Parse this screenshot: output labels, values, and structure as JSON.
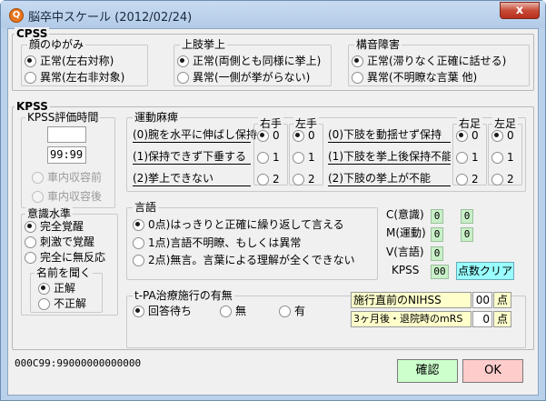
{
  "window": {
    "title": "脳卒中スケール (2012/02/24)",
    "close_label": "x",
    "icon_label": "Q"
  },
  "cpss": {
    "title": "CPSS",
    "face": {
      "title": "顔のゆがみ",
      "options": [
        "正常(左右対称)",
        "異常(左右非対象)"
      ],
      "selected": 0
    },
    "arm": {
      "title": "上肢挙上",
      "options": [
        "正常(両側とも同様に挙上)",
        "異常(一側が挙がらない)"
      ],
      "selected": 0
    },
    "speech": {
      "title": "構音障害",
      "options": [
        "正常(滞りなく正確に話せる)",
        "異常(不明瞭な言葉 他)"
      ],
      "selected": 0
    }
  },
  "kpss": {
    "title": "KPSS",
    "eval_time": {
      "title": "KPSS評価時間",
      "value": "",
      "time": "99:99",
      "options": [
        "車内収容前",
        "車内収容後"
      ]
    },
    "consciousness": {
      "title": "意識水準",
      "options": [
        "完全覚醒",
        "刺激で覚醒",
        "完全に無反応"
      ],
      "selected": 0
    },
    "name_ask": {
      "title": "名前を聞く",
      "options": [
        "正解",
        "不正解"
      ],
      "selected": 0
    },
    "motor": {
      "title": "運動麻痺",
      "right_hand": "右手",
      "left_hand": "左手",
      "right_foot": "右足",
      "left_foot": "左足",
      "arm_labels": [
        "(0)腕を水平に伸ばし保持",
        "(1)保持できず下垂する",
        "(2)挙上できない"
      ],
      "leg_labels": [
        "(0)下肢を動揺せず保持",
        "(1)下肢を挙上後保持不能",
        "(2)下肢の挙上が不能"
      ],
      "levels": [
        "0",
        "1",
        "2"
      ],
      "right_hand_sel": 0,
      "left_hand_sel": 0,
      "right_foot_sel": 0,
      "left_foot_sel": 0
    },
    "language": {
      "title": "言語",
      "options": [
        "0点)はっきりと正確に繰り返して言える",
        "1点)言語不明瞭、もしくは異常",
        "2点)無言。言葉による理解が全くできない"
      ],
      "selected": 0
    },
    "scores": {
      "c_label": "C(意識)",
      "c_val1": "0",
      "c_val2": "0",
      "m_label": "M(運動)",
      "m_val1": "0",
      "m_val2": "0",
      "v_label": "V(言語)",
      "v_val": "0",
      "kpss_label": "KPSS",
      "kpss_val": "00",
      "clear_label": "点数クリア"
    }
  },
  "tpa": {
    "title": "t-PA治療施行の有無",
    "options": [
      "回答待ち",
      "無",
      "有"
    ],
    "selected": 0,
    "nihss_label": "施行直前のNIHSS",
    "nihss_val": "00",
    "nihss_unit": "点",
    "mrs_label": "3ヶ月後・退院時のmRS",
    "mrs_val": "0",
    "mrs_unit": "点"
  },
  "status_code": "000C99:99000000000000",
  "buttons": {
    "confirm": "確認",
    "ok": "OK"
  },
  "colors": {
    "green_field": "#c8f0c8",
    "yellow_field": "#ffffcc",
    "cyan_button": "#99ffff",
    "confirm_btn": "#ccffcc",
    "ok_btn": "#ffcccc"
  }
}
